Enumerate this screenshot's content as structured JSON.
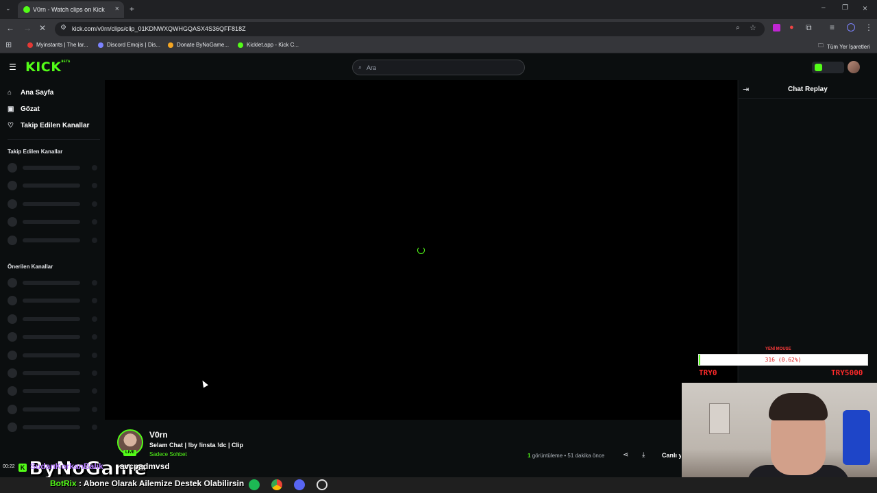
{
  "browser": {
    "tab_title": "V0rn - Watch clips on Kick",
    "url": "kick.com/v0rn/clips/clip_01KDNWXQWHGQASX4S36QFF818Z",
    "bookmarks": [
      {
        "label": "Myinstants | The lar...",
        "color": "#e53935"
      },
      {
        "label": "Discord Emojis | Dis...",
        "color": "#7c83ff"
      },
      {
        "label": "Donate ByNoGame...",
        "color": "#f5a623"
      },
      {
        "label": "Kicklet.app - Kick C...",
        "color": "#53fc18"
      }
    ],
    "all_bookmarks": "Tüm Yer İşaretleri"
  },
  "header": {
    "logo": "KICK",
    "logo_tag": "BETA",
    "search_placeholder": "Ara"
  },
  "sidebar": {
    "nav": [
      {
        "label": "Ana Sayfa",
        "icon": "home-icon"
      },
      {
        "label": "Gözat",
        "icon": "browse-icon"
      },
      {
        "label": "Takip Edilen Kanallar",
        "icon": "heart-icon"
      }
    ],
    "followed_heading": "Takip Edilen Kanallar",
    "recommended_heading": "Önerilen Kanallar"
  },
  "chat": {
    "title": "Chat Replay"
  },
  "clip": {
    "channel": "V0rn",
    "live_badge": "LIVE",
    "title": "Selam Chat  | !by !insta !dc | Clip",
    "category": "Sadece Sohbet",
    "views_count": "1",
    "views_label": "görüntüleme",
    "age": "51 dakika önce",
    "live_button": "Canlı y"
  },
  "overlay": {
    "goal_label": "YENİ MOUSE",
    "goal_text": "316 (0.62%)",
    "goal_progress": 0.0062,
    "goal_min": "TRY0",
    "goal_max": "TRY5000",
    "brand": "ByNoGame",
    "chat_user": "SudanKorkanBalık",
    "chat_message": "avcpadmvsd",
    "clock": "00:22",
    "bot_name": "BotRix",
    "bot_message": ": Abone Olarak Ailemize Destek Olabilirsin"
  }
}
